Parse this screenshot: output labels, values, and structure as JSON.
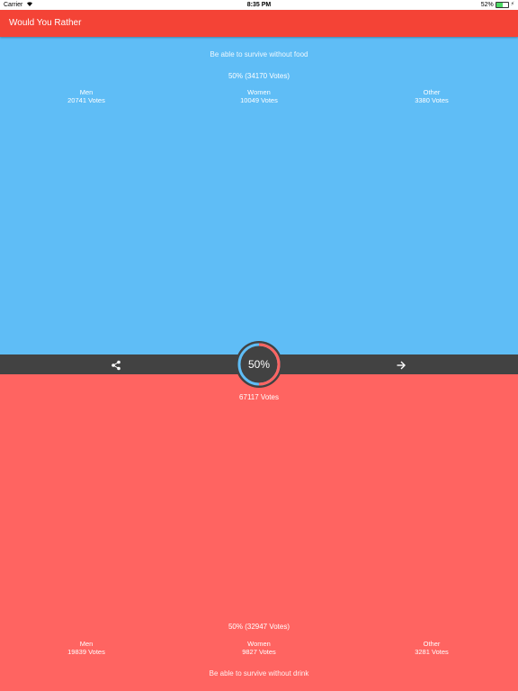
{
  "status_bar": {
    "carrier": "Carrier",
    "time": "8:35 PM",
    "battery": "52%",
    "battery_level": 0.52
  },
  "app_bar": {
    "title": "Would You Rather"
  },
  "option_a": {
    "text": "Be able to survive without food",
    "summary": "50% (34170  Votes)",
    "stats": [
      {
        "label": "Men",
        "votes": "20741  Votes"
      },
      {
        "label": "Women",
        "votes": "10049  Votes"
      },
      {
        "label": "Other",
        "votes": "3380  Votes"
      }
    ]
  },
  "option_b": {
    "text": "Be able to survive without drink",
    "summary": "50% (32947  Votes)",
    "stats": [
      {
        "label": "Men",
        "votes": "19839  Votes"
      },
      {
        "label": "Women",
        "votes": "9827  Votes"
      },
      {
        "label": "Other",
        "votes": "3281  Votes"
      }
    ]
  },
  "progress": {
    "label": "50%",
    "value": 0.5
  },
  "total_votes": "67117 Votes",
  "icons": {
    "share": "share-icon",
    "next": "arrow-right-icon",
    "wifi": "wifi-icon"
  },
  "colors": {
    "top": "#5fbdf6",
    "bottom": "#ff6461",
    "app_bar": "#f44336",
    "mid_bar": "#424242"
  }
}
